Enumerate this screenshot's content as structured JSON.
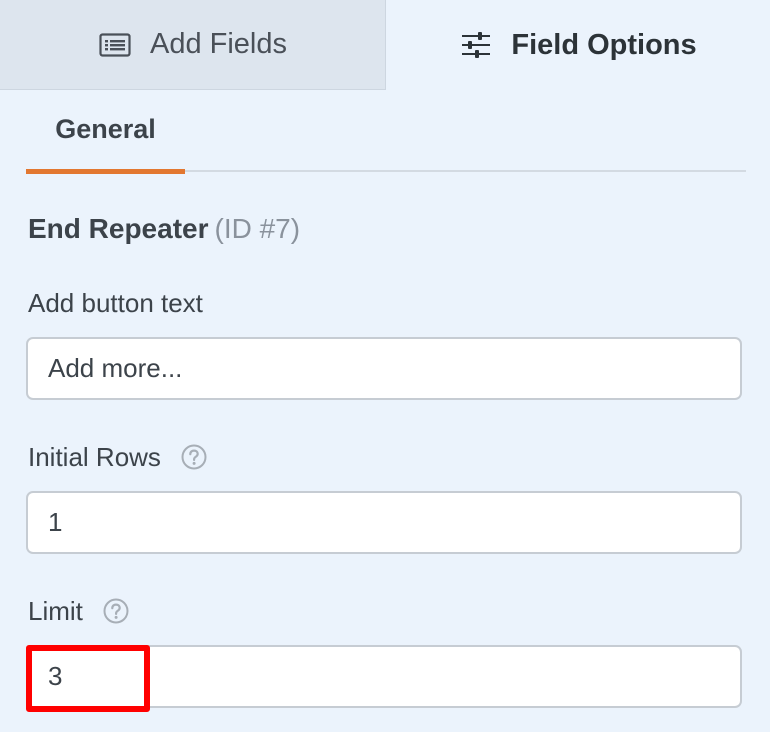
{
  "tabs": {
    "add_fields": {
      "label": "Add Fields",
      "icon": "list-icon"
    },
    "field_options": {
      "label": "Field Options",
      "icon": "sliders-icon"
    }
  },
  "sub_tabs": {
    "general": "General"
  },
  "field": {
    "name": "End Repeater",
    "id_text": "(ID #7)"
  },
  "options": {
    "add_button_text": {
      "label": "Add button text",
      "value": "Add more..."
    },
    "initial_rows": {
      "label": "Initial Rows",
      "value": "1"
    },
    "limit": {
      "label": "Limit",
      "value": "3"
    }
  },
  "colors": {
    "panel_bg": "#ebf3fc",
    "inactive_tab_bg": "#dde5ee",
    "accent": "#e27730",
    "highlight": "#ff0000"
  }
}
